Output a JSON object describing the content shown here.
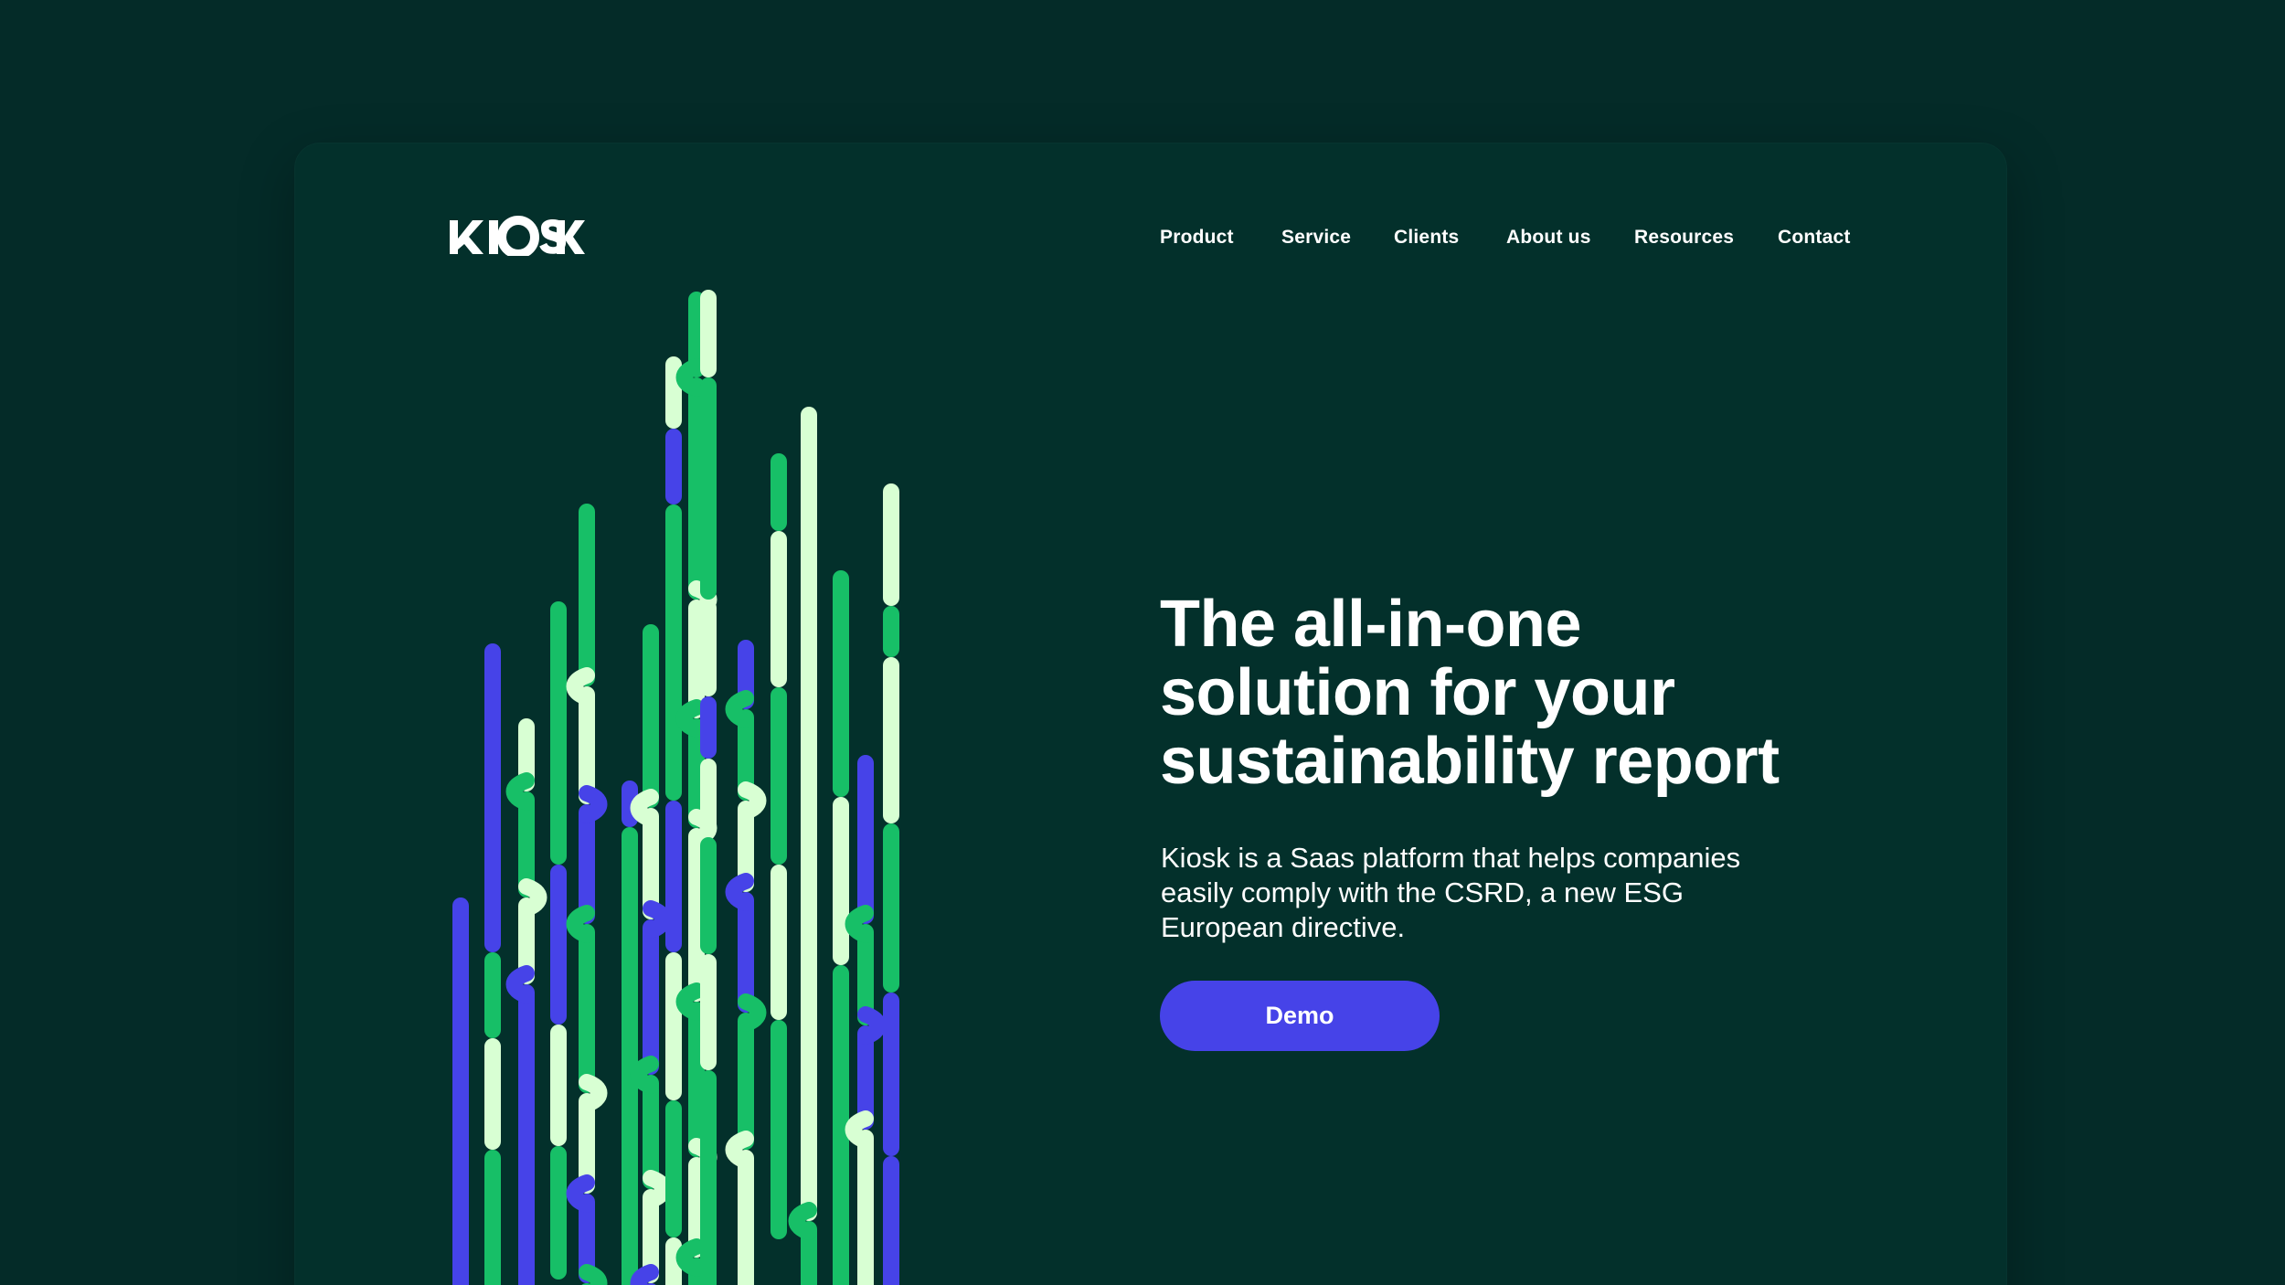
{
  "brand": {
    "name": "KIOSK",
    "colors": {
      "background": "#042b28",
      "card": "#03302b",
      "accent_blue": "#4643e8",
      "accent_green": "#17bf67",
      "accent_light": "#d8ffd3",
      "text": "#ffffff"
    }
  },
  "nav": {
    "items": [
      {
        "label": "Product"
      },
      {
        "label": "Service"
      },
      {
        "label": "Clients"
      },
      {
        "label": "About us"
      },
      {
        "label": "Resources"
      },
      {
        "label": "Contact"
      }
    ]
  },
  "hero": {
    "headline_lines": [
      "The all-in-one",
      "solution for your",
      "sustainability report"
    ],
    "description_lines": [
      "Kiosk is a Saas platform that helps companies",
      "easily comply with the CSRD, a new ESG",
      "European directive."
    ],
    "cta_label": "Demo"
  }
}
